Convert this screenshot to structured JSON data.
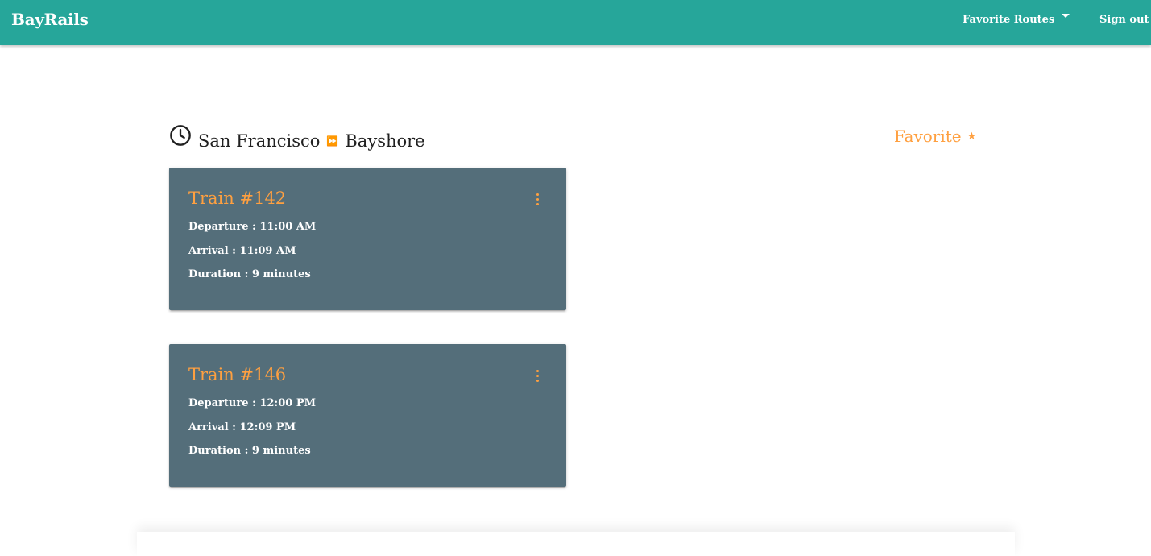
{
  "navbar": {
    "brand": "BayRails",
    "favorite_routes": "Favorite Routes",
    "sign_out": "Sign out",
    "color": "#26a69a"
  },
  "route": {
    "origin": "San Francisco",
    "arrow": "⏩",
    "destination": "Bayshore",
    "favorite_label": "Favorite",
    "favorite_star": "★"
  },
  "trains": [
    {
      "title": "Train #142",
      "departure": "Departure : 11:00 AM",
      "arrival": "Arrival : 11:09 AM",
      "duration": "Duration : 9 minutes"
    },
    {
      "title": "Train #146",
      "departure": "Departure : 12:00 PM",
      "arrival": "Arrival : 12:09 PM",
      "duration": "Duration : 9 minutes"
    }
  ],
  "colors": {
    "accent": "#ffa040",
    "card_bg": "#546e7a"
  },
  "icons": {
    "clock": "clock-icon",
    "star": "star-icon",
    "more": "more-vert-icon",
    "caret": "caret-down-icon"
  }
}
